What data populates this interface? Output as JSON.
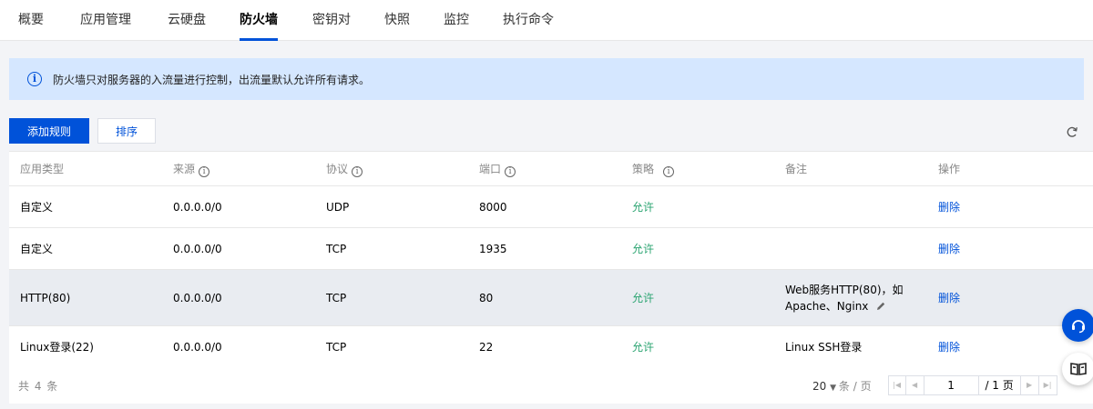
{
  "tabs": [
    {
      "label": "概要"
    },
    {
      "label": "应用管理"
    },
    {
      "label": "云硬盘"
    },
    {
      "label": "防火墙",
      "active": true
    },
    {
      "label": "密钥对"
    },
    {
      "label": "快照"
    },
    {
      "label": "监控"
    },
    {
      "label": "执行命令"
    }
  ],
  "banner": {
    "text": "防火墙只对服务器的入流量进行控制，出流量默认允许所有请求。",
    "icon": "info-icon"
  },
  "toolbar": {
    "add_rule_label": "添加规则",
    "sort_label": "排序",
    "refresh_icon": "refresh-icon"
  },
  "table": {
    "headers": [
      "应用类型",
      "来源",
      "协议",
      "端口",
      "策略",
      "备注",
      "操作"
    ],
    "rows": [
      {
        "type": "自定义",
        "source": "0.0.0.0/0",
        "protocol": "UDP",
        "port": "8000",
        "policy": "允许",
        "note_line1": "",
        "note_line2": "",
        "action": "删除"
      },
      {
        "type": "自定义",
        "source": "0.0.0.0/0",
        "protocol": "TCP",
        "port": "1935",
        "policy": "允许",
        "note_line1": "",
        "note_line2": "",
        "action": "删除"
      },
      {
        "type": "HTTP(80)",
        "source": "0.0.0.0/0",
        "protocol": "TCP",
        "port": "80",
        "policy": "允许",
        "note_line1": "Web服务HTTP(80)，如",
        "note_line2": "Apache、Nginx",
        "action": "删除"
      },
      {
        "type": "Linux登录(22)",
        "source": "0.0.0.0/0",
        "protocol": "TCP",
        "port": "22",
        "policy": "允许",
        "note_line1": "Linux SSH登录",
        "note_line2": "",
        "action": "删除"
      }
    ]
  },
  "footer": {
    "total_text": "共 4 条",
    "page_size": "20",
    "page_size_unit": "条 / 页",
    "current_page": "1",
    "total_pages_text": "/ 1 页"
  },
  "colors": {
    "primary": "#0052d9",
    "allow": "#2ba471",
    "banner_bg": "#d5e7ff"
  }
}
